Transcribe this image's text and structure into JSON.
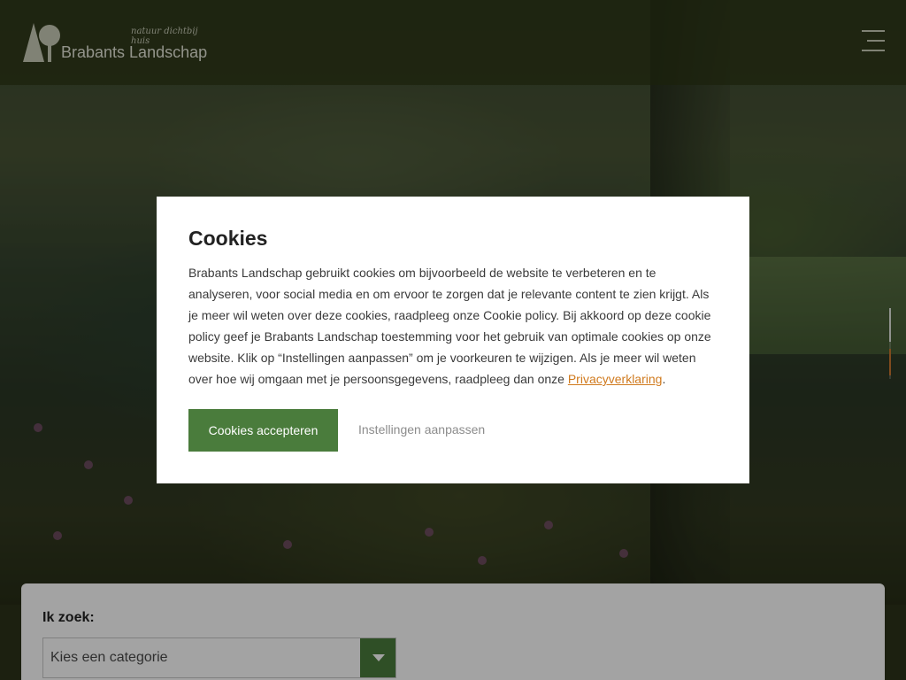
{
  "header": {
    "logo": {
      "tagline": "natuur dichtbij huis",
      "name": "Brabants Landschap",
      "icon": "tree-logo-icon"
    },
    "menu_icon": "hamburger-menu-icon"
  },
  "search": {
    "label": "Ik zoek:",
    "select_value": "Kies een categorie",
    "arrow_icon": "chevron-down-icon"
  },
  "cookie_dialog": {
    "title": "Cookies",
    "body_text": "Brabants Landschap gebruikt cookies om bijvoorbeeld de website te verbeteren en te analyseren, voor social media en om ervoor te zorgen dat je relevante content te zien krijgt. Als je meer wil weten over deze cookies, raadpleeg onze Cookie policy. Bij akkoord op deze cookie policy geef je Brabants Landschap toestemming voor het gebruik van optimale cookies op onze website. Klik op “Instellingen aanpassen” om je voorkeuren te wijzigen. Als je meer wil weten over hoe wij omgaan met je persoonsgegevens, raadpleeg dan onze ",
    "privacy_link": "Privacyverklaring",
    "trailing": ".",
    "accept_label": "Cookies accepteren",
    "settings_label": "Instellingen aanpassen"
  },
  "colors": {
    "brand_green": "#4a7c3c",
    "link_orange": "#d07a1e",
    "header_bg": "#2b3414"
  }
}
